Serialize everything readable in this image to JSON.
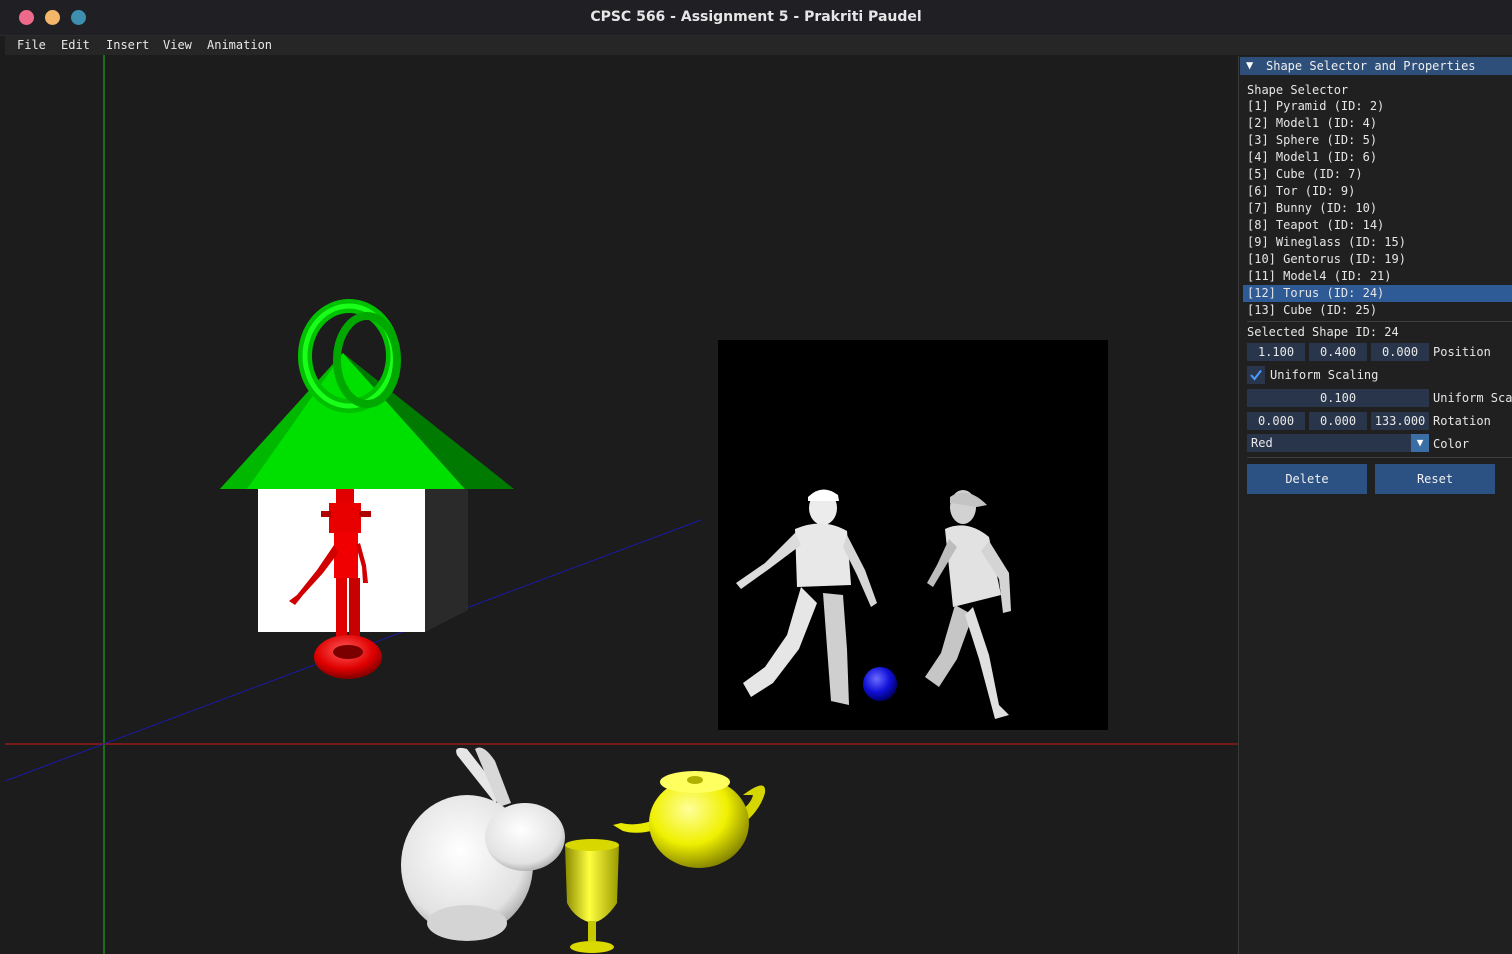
{
  "window": {
    "title": "CPSC 566 - Assignment 5 - Prakriti Paudel"
  },
  "menubar": {
    "items": [
      "File",
      "Edit",
      "Insert",
      "View",
      "Animation"
    ]
  },
  "panel": {
    "header": "Shape Selector and Properties",
    "section_label": "Shape Selector",
    "shapes": [
      "[1] Pyramid (ID: 2)",
      "[2] Model1 (ID: 4)",
      "[3] Sphere (ID: 5)",
      "[4] Model1 (ID: 6)",
      "[5] Cube (ID: 7)",
      "[6] Tor (ID: 9)",
      "[7] Bunny (ID: 10)",
      "[8] Teapot (ID: 14)",
      "[9] Wineglass (ID: 15)",
      "[10] Gentorus (ID: 19)",
      "[11] Model4 (ID: 21)",
      "[12] Torus (ID: 24)",
      "[13] Cube (ID: 25)"
    ],
    "selected_index": 11,
    "selected_shape_label": "Selected Shape ID: 24",
    "position": {
      "x": "1.100",
      "y": "0.400",
      "z": "0.000",
      "label": "Position"
    },
    "uniform_scaling": {
      "checked": true,
      "label": "Uniform Scaling"
    },
    "uniform_scale": {
      "value": "0.100",
      "label": "Uniform Scale"
    },
    "rotation": {
      "x": "0.000",
      "y": "0.000",
      "z": "133.000",
      "label": "Rotation"
    },
    "color": {
      "value": "Red",
      "label": "Color"
    },
    "delete_label": "Delete",
    "reset_label": "Reset"
  },
  "colors": {
    "panel_header": "#2e4f7a",
    "selection": "#2e5a96",
    "field": "#29354a",
    "button": "#2c5284",
    "axis_x": "#d01818",
    "axis_y": "#19c419",
    "axis_z": "#1a1aa8"
  }
}
